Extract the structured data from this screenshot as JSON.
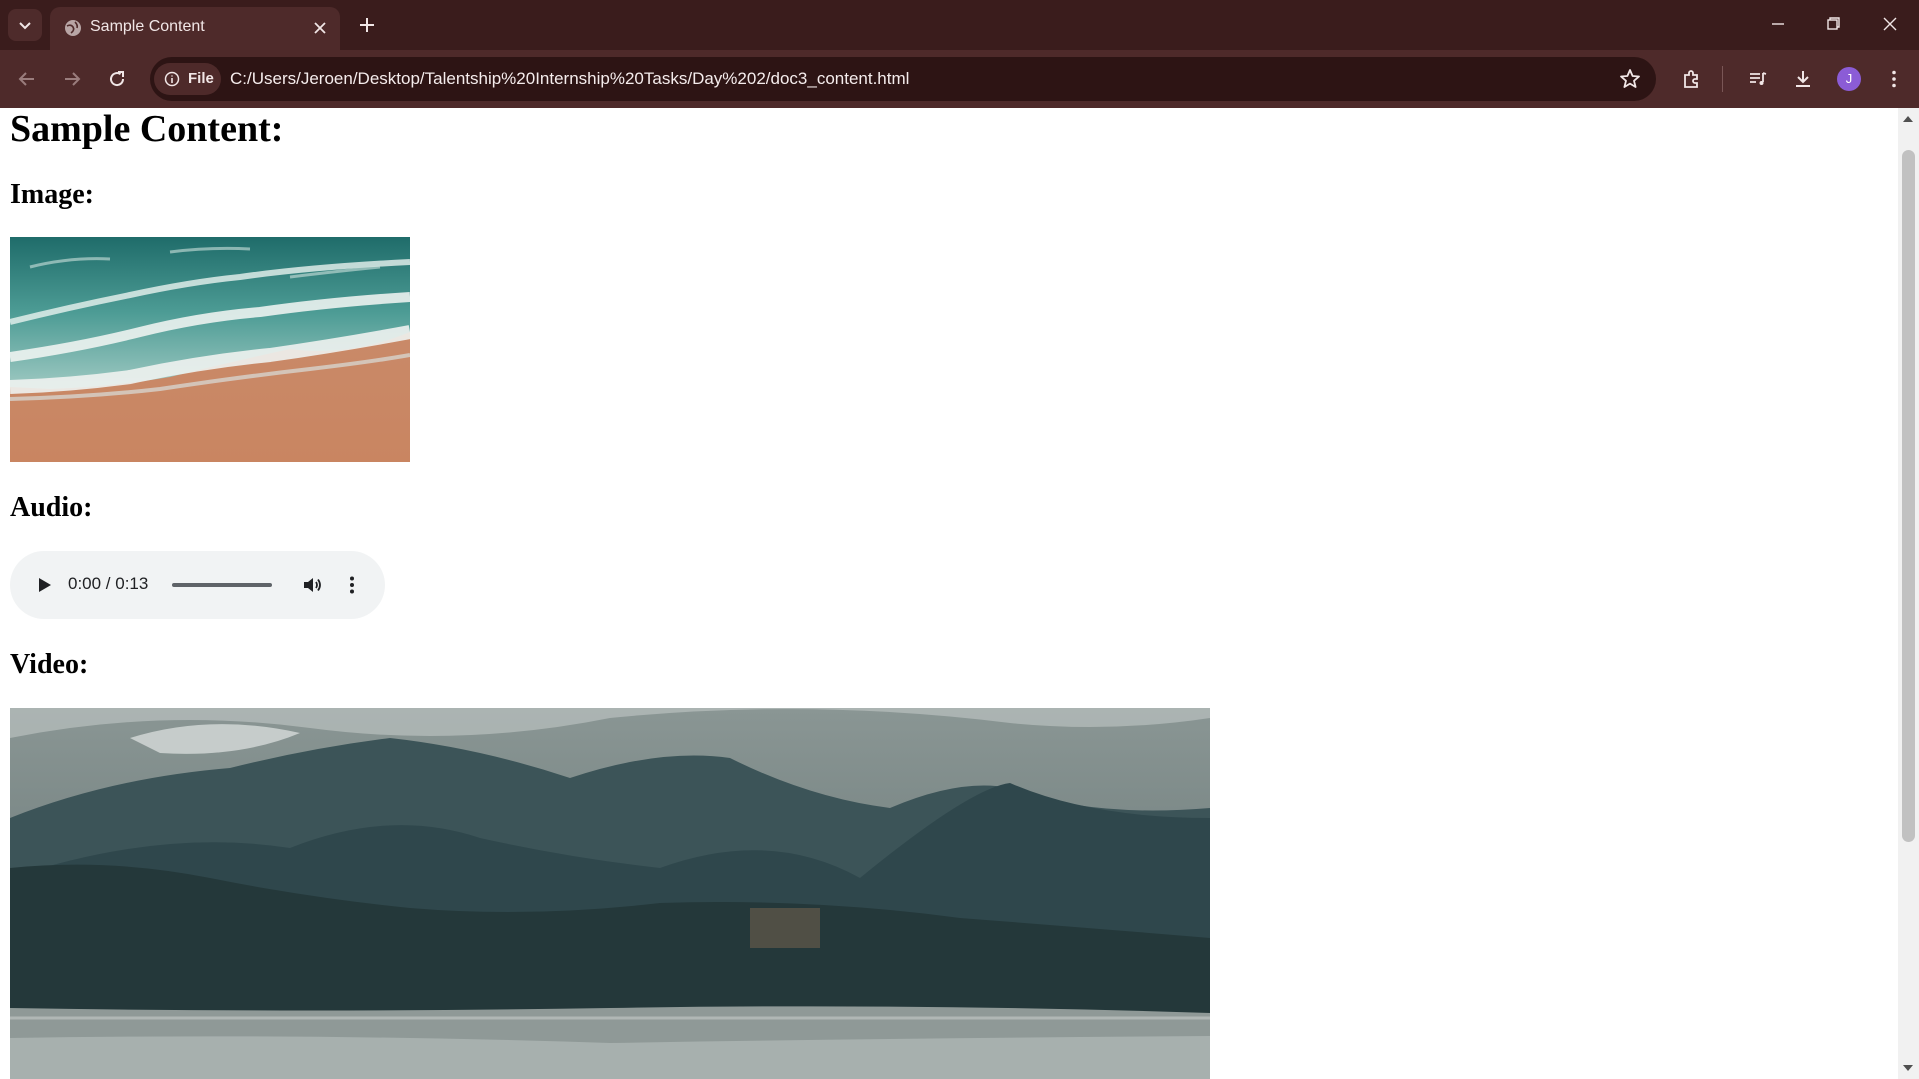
{
  "browser": {
    "tab": {
      "title": "Sample Content"
    },
    "address_bar": {
      "site_chip": "File",
      "url": "C:/Users/Jeroen/Desktop/Talentship%20Internship%20Tasks/Day%202/doc3_content.html"
    },
    "profile_initial": "J",
    "icons": [
      "tab-search-icon",
      "globe-icon",
      "close-icon",
      "plus-icon",
      "minimize-icon",
      "restore-icon",
      "close-window-icon",
      "back-icon",
      "forward-icon",
      "reload-icon",
      "info-icon",
      "star-icon",
      "extensions-icon",
      "media-controls-icon",
      "download-icon",
      "more-vert-icon"
    ],
    "colors": {
      "frame": "#3a1c1c",
      "toolbar": "#4e2a2a",
      "omnibox": "#2d1414",
      "avatar": "#8b5cd6"
    }
  },
  "page": {
    "title": "Sample Content:",
    "image_heading": "Image:",
    "audio_heading": "Audio:",
    "audio": {
      "time": "0:00 / 0:13"
    },
    "video_heading": "Video:"
  }
}
